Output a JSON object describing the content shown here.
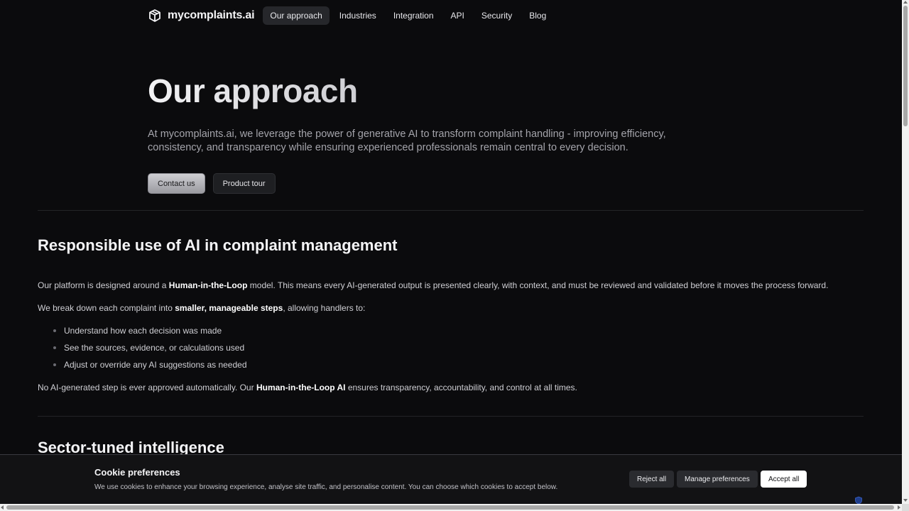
{
  "nav": {
    "brand": "mycomplaints.ai",
    "items": [
      {
        "label": "Our approach",
        "active": true
      },
      {
        "label": "Industries"
      },
      {
        "label": "Integration"
      },
      {
        "label": "API"
      },
      {
        "label": "Security"
      },
      {
        "label": "Blog"
      }
    ]
  },
  "hero": {
    "title": "Our approach",
    "description": "At mycomplaints.ai, we leverage the power of generative AI to transform complaint handling - improving efficiency, consistency, and transparency while ensuring experienced professionals remain central to every decision.",
    "primary_button": "Contact us",
    "secondary_button": "Product tour"
  },
  "section1": {
    "title": "Responsible use of AI in complaint management",
    "p1_before": "Our platform is designed around a ",
    "p1_bold": "Human-in-the-Loop",
    "p1_after": " model. This means every AI-generated output is presented clearly, with context, and must be reviewed and validated before it moves the process forward.",
    "p2_before": "We break down each complaint into ",
    "p2_bold": "smaller, manageable steps",
    "p2_after": ", allowing handlers to:",
    "bullets": [
      "Understand how each decision was made",
      "See the sources, evidence, or calculations used",
      "Adjust or override any AI suggestions as needed"
    ],
    "p3_before": "No AI-generated step is ever approved automatically. Our ",
    "p3_bold": "Human-in-the-Loop AI",
    "p3_after": " ensures transparency, accountability, and control at all times."
  },
  "section2": {
    "title": "Sector-tuned intelligence"
  },
  "cookie": {
    "title": "Cookie preferences",
    "text": "We use cookies to enhance your browsing experience, analyse site traffic, and personalise content. You can choose which cookies to accept below.",
    "reject": "Reject all",
    "manage": "Manage preferences",
    "accept": "Accept all"
  },
  "colors": {
    "background": "#0b0b0d",
    "accent_button": "#ffffff"
  }
}
